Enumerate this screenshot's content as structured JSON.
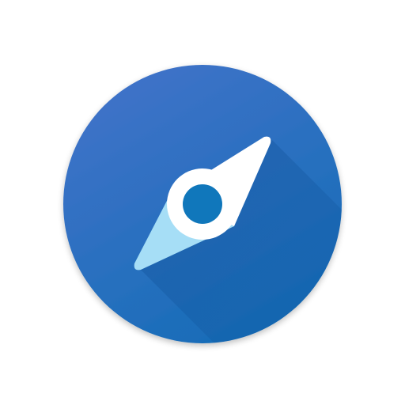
{
  "icon": {
    "name": "compass-icon",
    "colors": {
      "background": "#ffffff",
      "circle_top": "#3f6fc8",
      "circle_bottom": "#1a6bb8",
      "long_shadow": "#1c5aa6",
      "needle_north": "#ffffff",
      "needle_south": "#a6def6",
      "hub": "#ffffff",
      "hub_center": "#1077bb"
    }
  }
}
